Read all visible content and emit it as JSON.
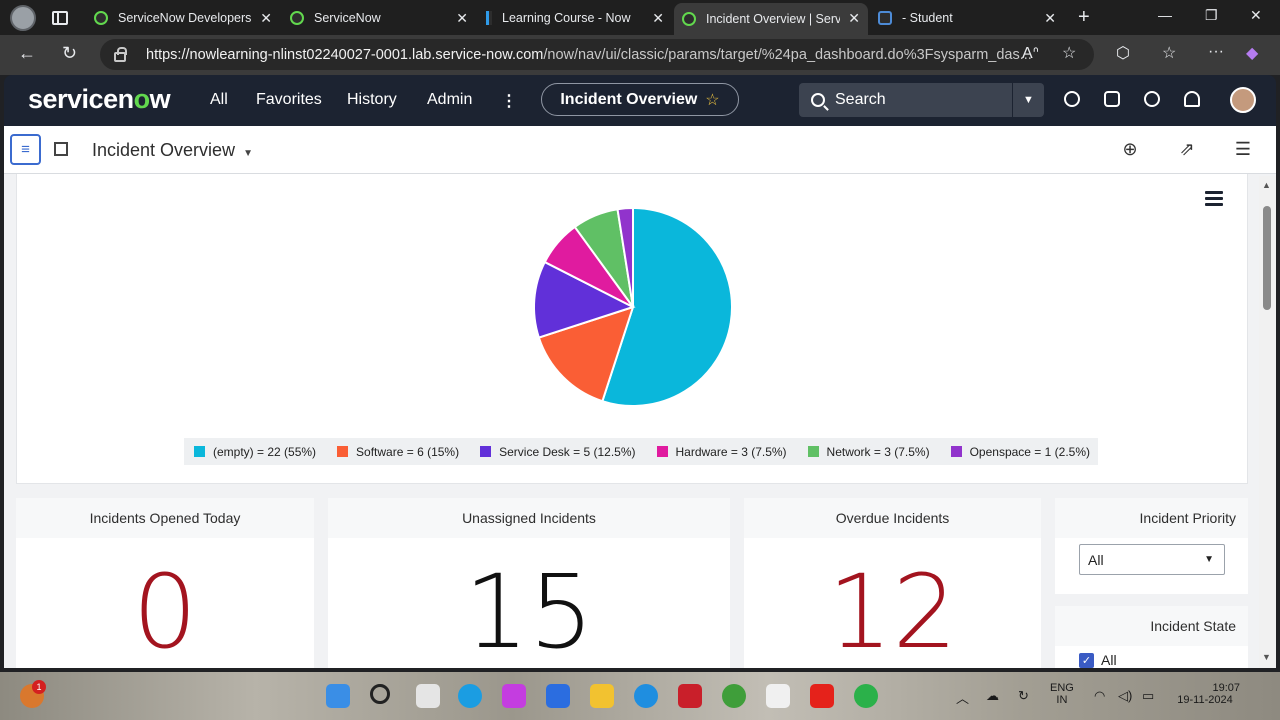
{
  "browser": {
    "tabs": [
      {
        "title": "ServiceNow Developers",
        "active": false
      },
      {
        "title": "ServiceNow",
        "active": false
      },
      {
        "title": "Learning Course - Now Le",
        "active": false
      },
      {
        "title": "Incident Overview | Servic",
        "active": true
      },
      {
        "title": "- Student",
        "active": false
      }
    ],
    "url_host": "https://nowlearning-nlinst02240027-0001.lab.service-now.com",
    "url_path": "/now/nav/ui/classic/params/target/%24pa_dashboard.do%3Fsysparm_das..."
  },
  "sn_header": {
    "logo_a": "servicen",
    "logo_o": "o",
    "logo_b": "w",
    "nav": [
      "All",
      "Favorites",
      "History",
      "Admin"
    ],
    "context_pill": "Incident Overview",
    "search_placeholder": "Search"
  },
  "dashboard": {
    "title": "Incident Overview"
  },
  "chart_data": {
    "type": "pie",
    "categories": [
      "(empty)",
      "Software",
      "Service Desk",
      "Hardware",
      "Network",
      "Openspace"
    ],
    "values": [
      22,
      6,
      5,
      3,
      3,
      1
    ],
    "colors": [
      "#0ab7db",
      "#fa5e35",
      "#6130d9",
      "#e01b9f",
      "#60c065",
      "#9133cc"
    ],
    "legend": [
      "(empty) = 22 (55%)",
      "Software = 6 (15%)",
      "Service Desk = 5 (12.5%)",
      "Hardware = 3 (7.5%)",
      "Network = 3 (7.5%)",
      "Openspace = 1 (2.5%)"
    ],
    "legend_position": "bottom"
  },
  "tiles": [
    {
      "label": "Incidents Opened Today",
      "value": "0",
      "color": "#a3141f"
    },
    {
      "label": "Unassigned Incidents",
      "value": "15",
      "color": "#111111"
    },
    {
      "label": "Overdue Incidents",
      "value": "12",
      "color": "#a3141f"
    }
  ],
  "filters": {
    "priority": {
      "label": "Incident Priority",
      "selected": "All"
    },
    "state": {
      "label": "Incident State",
      "checked_option": "All"
    }
  },
  "taskbar": {
    "lang": "ENG",
    "region": "IN",
    "time": "19:07",
    "date": "19-11-2024",
    "notification_count": "1"
  }
}
